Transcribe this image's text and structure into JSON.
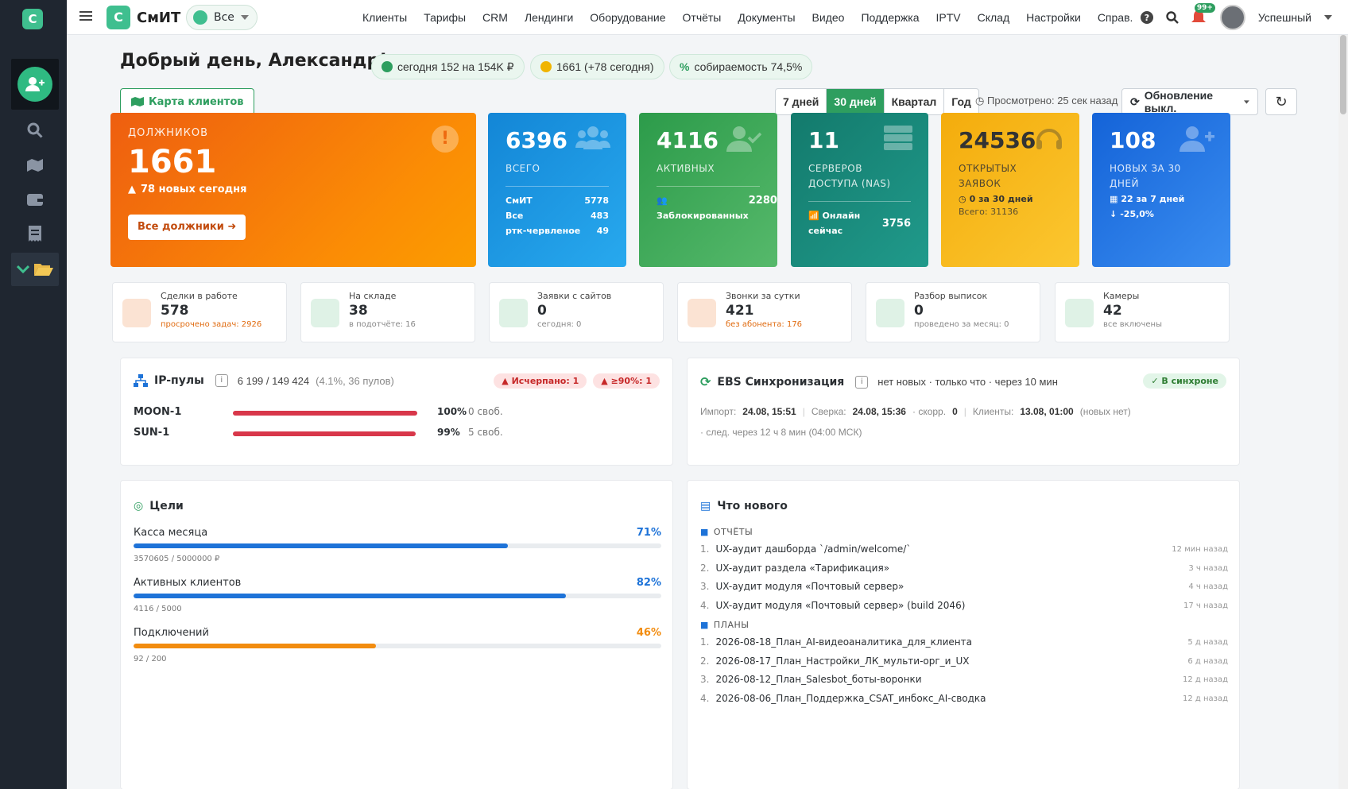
{
  "app": {
    "logo_letter": "С",
    "brand": "СмИТ",
    "org": "Все",
    "user": "Успешный",
    "notif_count": "99+"
  },
  "nav": [
    "Клиенты",
    "Тарифы",
    "CRM",
    "Лендинги",
    "Оборудование",
    "Отчёты",
    "Документы",
    "Видео",
    "Поддержка",
    "IPTV",
    "Склад",
    "Настройки",
    "Справ."
  ],
  "header": {
    "greeting": "Добрый день, Александр!",
    "pill_today": "сегодня 152 на  154K ₽",
    "pill_debt": "1661 (+78 сегодня)",
    "pill_collect": "собираемость  74,5%",
    "map_btn": "Карта клиентов",
    "periods": [
      "7 дней",
      "30 дней",
      "Квартал",
      "Год"
    ],
    "active_period": "30 дней",
    "viewed": "Просмотрено: 25 сек назад",
    "update": "Обновление выкл."
  },
  "debtors": {
    "title": "ДОЛЖНИКОВ",
    "value": "1661",
    "new_today": "78 новых сегодня",
    "btn": "Все должники"
  },
  "k_all": {
    "value": "6396",
    "label": "ВСЕГО",
    "rows": [
      [
        "СмИТ",
        "5778"
      ],
      [
        "Все",
        "483"
      ],
      [
        "ртк-червленое",
        "49"
      ]
    ]
  },
  "k_act": {
    "value": "4116",
    "label": "АКТИВНЫХ",
    "blocked_label": "Заблокированных",
    "blocked": "2280"
  },
  "k_nas": {
    "value": "11",
    "label": "СЕРВЕРОВ ДОСТУПА",
    "label2": "(NAS)",
    "online_label": "Онлайн сейчас",
    "online": "3756"
  },
  "k_req": {
    "value": "24536",
    "label": "ОТКРЫТЫХ ЗАЯВОК",
    "sub1": "0 за 30 дней",
    "sub2": "Всего: 31136"
  },
  "k_new": {
    "value": "108",
    "label": "НОВЫХ ЗА 30 ДНЕЙ",
    "sub1": "22 за 7 дней",
    "sub2": "-25,0%"
  },
  "minis": [
    {
      "title": "Сделки в работе",
      "value": "578",
      "sub": "просрочено задач: 2926",
      "color": "#fbe3d3",
      "sub_orange": true
    },
    {
      "title": "На складе",
      "value": "38",
      "sub": "в подотчёте: 16",
      "color": "#dff2e6",
      "sub_orange": false
    },
    {
      "title": "Заявки с сайтов",
      "value": "0",
      "sub": "сегодня: 0",
      "color": "#dff2e6",
      "sub_orange": false
    },
    {
      "title": "Звонки за сутки",
      "value": "421",
      "sub": "без абонента: 176",
      "color": "#fbe3d3",
      "sub_orange": true
    },
    {
      "title": "Разбор выписок",
      "value": "0",
      "sub": "проведено за месяц: 0",
      "color": "#dff2e6",
      "sub_orange": false
    },
    {
      "title": "Камеры",
      "value": "42",
      "sub": "все включены",
      "color": "#dff2e6",
      "sub_orange": false
    }
  ],
  "ip": {
    "title": "IP-пулы",
    "summary": "6 199 / 149 424",
    "summary2": "(4.1%, 36 пулов)",
    "badge1": "Исчерпано: 1",
    "badge2": "≥90%: 1",
    "pools": [
      {
        "name": "MOON-1",
        "pct": "100%",
        "free": "0 своб.",
        "fill": 1.0
      },
      {
        "name": "SUN-1",
        "pct": "99%",
        "free": "5 своб.",
        "fill": 0.99
      }
    ]
  },
  "ebs": {
    "title": "EBS Синхронизация",
    "status": "нет новых · только что · через 10 мин",
    "badge": "✓ В синхроне",
    "import_label": "Импорт:",
    "import": "24.08, 15:51",
    "check_label": "Сверка:",
    "check": "24.08, 15:36",
    "speed_label": "· скорр.",
    "speed": "0",
    "clients_label": "Клиенты:",
    "clients": "13.08, 01:00",
    "clients_note": "(новых нет)",
    "next": "· след. через 12 ч 8 мин (04:00 МСК)"
  },
  "goals": {
    "title": "Цели",
    "items": [
      {
        "name": "Касса месяца",
        "pct": "71%",
        "sub": "3570605 / 5000000 ₽",
        "fill": 0.71,
        "color": "#1e73d8"
      },
      {
        "name": "Активных клиентов",
        "pct": "82%",
        "sub": "4116 / 5000",
        "fill": 0.82,
        "color": "#1e73d8"
      },
      {
        "name": "Подключений",
        "pct": "46%",
        "sub": "92 / 200",
        "fill": 0.46,
        "color": "#f28c0f"
      }
    ]
  },
  "news": {
    "title": "Что нового",
    "reports_label": "ОТЧЁТЫ",
    "reports": [
      [
        "UX-аудит дашборда `/admin/welcome/`",
        "12 мин назад"
      ],
      [
        "UX-аудит раздела «Тарификация»",
        "3 ч назад"
      ],
      [
        "UX-аудит модуля «Почтовый сервер»",
        "4 ч назад"
      ],
      [
        "UX-аудит модуля «Почтовый сервер» (build 2046)",
        "17 ч назад"
      ]
    ],
    "plans_label": "ПЛАНЫ",
    "plans": [
      [
        "2026-08-18_План_AI-видеоаналитика_для_клиента",
        "5 д назад"
      ],
      [
        "2026-08-17_План_Настройки_ЛК_мульти-орг_и_UX",
        "6 д назад"
      ],
      [
        "2026-08-12_План_Salesbot_боты-воронки",
        "12 д назад"
      ],
      [
        "2026-08-06_План_Поддержка_CSAT_инбокс_AI-сводка",
        "12 д назад"
      ]
    ]
  }
}
